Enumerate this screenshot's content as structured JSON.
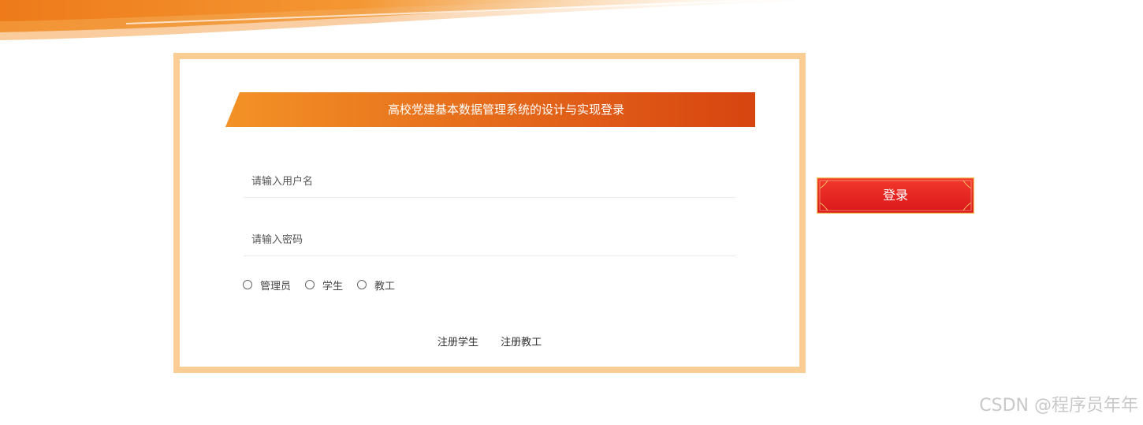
{
  "login": {
    "title": "高校党建基本数据管理系统的设计与实现登录",
    "username_placeholder": "请输入用户名",
    "password_placeholder": "请输入密码",
    "roles": [
      {
        "label": "管理员"
      },
      {
        "label": "学生"
      },
      {
        "label": "教工"
      }
    ],
    "register_links": [
      {
        "label": "注册学生"
      },
      {
        "label": "注册教工"
      }
    ],
    "login_button": "登录"
  },
  "watermark": "CSDN @程序员年年",
  "colors": {
    "frame_border": "#f9cd94",
    "banner_start": "#f39226",
    "banner_end": "#d74410",
    "button_red": "#e4211f",
    "button_gold_border": "#f3c35b"
  }
}
